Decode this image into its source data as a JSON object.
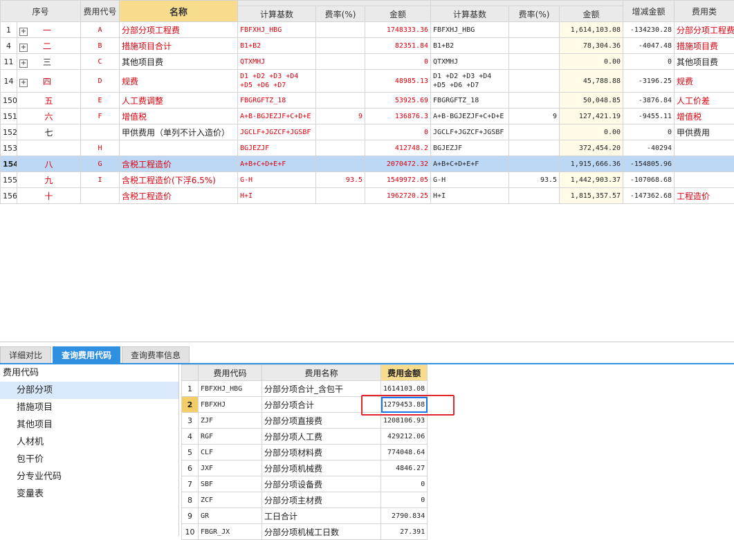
{
  "main_table": {
    "headers_top": [
      "序号",
      "费用代号",
      "名称",
      "",
      "",
      "",
      "",
      "",
      "",
      "增减金额",
      "费用类"
    ],
    "headers_sub": [
      "计算基数",
      "费率(%)",
      "金额",
      "计算基数",
      "费率(%)",
      "金额"
    ],
    "rows": [
      {
        "no": "1",
        "expand": "+",
        "seq": "一",
        "code": "A",
        "name": "分部分项工程费",
        "base1": "FBFXHJ_HBG",
        "rate1": "",
        "amt1": "1748333.36",
        "base2": "FBFXHJ_HBG",
        "rate2": "",
        "amt2": "1,614,103.08",
        "diff": "-134230.28",
        "type": "分部分项工程费",
        "red": true
      },
      {
        "no": "4",
        "expand": "+",
        "seq": "二",
        "code": "B",
        "name": "措施项目合计",
        "base1": "B1+B2",
        "rate1": "",
        "amt1": "82351.84",
        "base2": "B1+B2",
        "rate2": "",
        "amt2": "78,304.36",
        "diff": "-4047.48",
        "type": "措施项目费",
        "red": true
      },
      {
        "no": "11",
        "expand": "+",
        "seq": "三",
        "code": "C",
        "name": "其他项目费",
        "base1": "QTXMHJ",
        "rate1": "",
        "amt1": "0",
        "base2": "QTXMHJ",
        "rate2": "",
        "amt2": "0.00",
        "diff": "0",
        "type": "其他项目费",
        "red": false
      },
      {
        "no": "14",
        "expand": "+",
        "seq": "四",
        "code": "D",
        "name": "规费",
        "base1": "D1 +D2 +D3 +D4 +D5 +D6 +D7",
        "rate1": "",
        "amt1": "48985.13",
        "base2": "D1 +D2 +D3 +D4 +D5 +D6 +D7",
        "rate2": "",
        "amt2": "45,788.88",
        "diff": "-3196.25",
        "type": "规费",
        "red": true
      },
      {
        "no": "150",
        "expand": "",
        "seq": "五",
        "code": "E",
        "name": "人工费调整",
        "base1": "FBGRGFTZ_18",
        "rate1": "",
        "amt1": "53925.69",
        "base2": "FBGRGFTZ_18",
        "rate2": "",
        "amt2": "50,048.85",
        "diff": "-3876.84",
        "type": "人工价差",
        "red": true
      },
      {
        "no": "151",
        "expand": "",
        "seq": "六",
        "code": "F",
        "name": "增值税",
        "base1": "A+B-BGJEZJF+C+D+E",
        "rate1": "9",
        "amt1": "136876.3",
        "base2": "A+B-BGJEZJF+C+D+E",
        "rate2": "9",
        "amt2": "127,421.19",
        "diff": "-9455.11",
        "type": "增值税",
        "red": true
      },
      {
        "no": "152",
        "expand": "",
        "seq": "七",
        "code": "",
        "name": "甲供费用（单列不计入造价）",
        "base1": "JGCLF+JGZCF+JGSBF",
        "rate1": "",
        "amt1": "0",
        "base2": "JGCLF+JGZCF+JGSBF",
        "rate2": "",
        "amt2": "0.00",
        "diff": "0",
        "type": "甲供费用",
        "red": false
      },
      {
        "no": "153",
        "expand": "",
        "seq": "",
        "code": "H",
        "name": "",
        "base1": "BGJEZJF",
        "rate1": "",
        "amt1": "412748.2",
        "base2": "BGJEZJF",
        "rate2": "",
        "amt2": "372,454.20",
        "diff": "-40294",
        "type": "",
        "red": true
      },
      {
        "no": "154",
        "expand": "",
        "seq": "八",
        "code": "G",
        "name": "含税工程造价",
        "base1": "A+B+C+D+E+F",
        "rate1": "",
        "amt1": "2070472.32",
        "base2": "A+B+C+D+E+F",
        "rate2": "",
        "amt2": "1,915,666.36",
        "diff": "-154805.96",
        "type": "",
        "red": true,
        "selected": true
      },
      {
        "no": "155",
        "expand": "",
        "seq": "九",
        "code": "I",
        "name": "含税工程造价(下浮6.5%)",
        "base1": "G-H",
        "rate1": "93.5",
        "amt1": "1549972.05",
        "base2": "G-H",
        "rate2": "93.5",
        "amt2": "1,442,903.37",
        "diff": "-107068.68",
        "type": "",
        "red": true
      },
      {
        "no": "156",
        "expand": "",
        "seq": "十",
        "code": "",
        "name": "含税工程造价",
        "base1": "H+I",
        "rate1": "",
        "amt1": "1962720.25",
        "base2": "H+I",
        "rate2": "",
        "amt2": "1,815,357.57",
        "diff": "-147362.68",
        "type": "工程造价",
        "red": true
      }
    ]
  },
  "tabs": [
    "详细对比",
    "查询费用代码",
    "查询费率信息"
  ],
  "tree": {
    "root": "费用代码",
    "items": [
      "分部分项",
      "措施项目",
      "其他项目",
      "人材机",
      "包干价",
      "分专业代码",
      "变量表"
    ]
  },
  "sub_table": {
    "headers": [
      "",
      "费用代码",
      "费用名称",
      "费用金额"
    ],
    "rows": [
      [
        "1",
        "FBFXHJ_HBG",
        "分部分项合计_含包干",
        "1614103.08"
      ],
      [
        "2",
        "FBFXHJ",
        "分部分项合计",
        "1279453.88"
      ],
      [
        "3",
        "ZJF",
        "分部分项直接费",
        "1208106.93"
      ],
      [
        "4",
        "RGF",
        "分部分项人工费",
        "429212.06"
      ],
      [
        "5",
        "CLF",
        "分部分项材料费",
        "774048.64"
      ],
      [
        "6",
        "JXF",
        "分部分项机械费",
        "4846.27"
      ],
      [
        "7",
        "SBF",
        "分部分项设备费",
        "0"
      ],
      [
        "8",
        "ZCF",
        "分部分项主材费",
        "0"
      ],
      [
        "9",
        "GR",
        "工日合计",
        "2790.834"
      ],
      [
        "10",
        "FBGR_JX",
        "分部分项机械工日数",
        "27.391"
      ]
    ]
  }
}
